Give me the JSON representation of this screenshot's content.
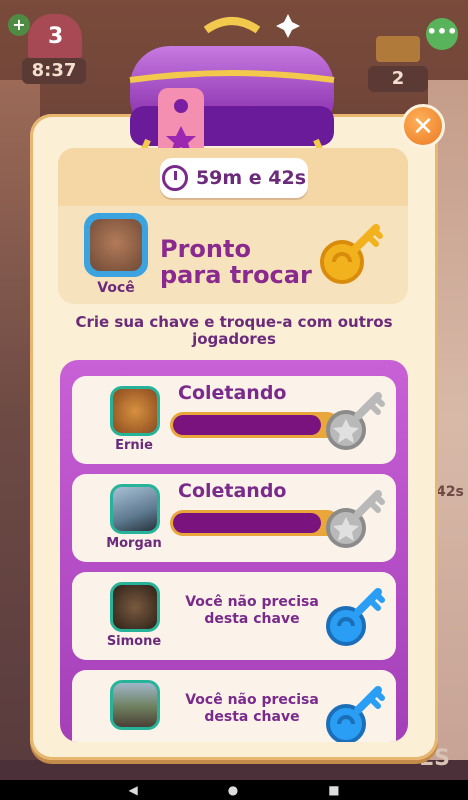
{
  "hud": {
    "lives": "3",
    "lives_timer": "8:37",
    "add_label": "+",
    "gold_count": "2",
    "menu_label": "•••"
  },
  "background": {
    "right_timer": "42s",
    "bottom_letters": "ES"
  },
  "chest": {
    "timer": "59m e 42s"
  },
  "you": {
    "label": "Você",
    "status": "Pronto para trocar"
  },
  "subtitle": "Crie sua chave e troque-a com outros jogadores",
  "rows": [
    {
      "name": "Ernie",
      "status": "Coletando",
      "type": "progress",
      "progress": 0.9
    },
    {
      "name": "Morgan",
      "status": "Coletando",
      "type": "progress",
      "progress": 0.9
    },
    {
      "name": "Simone",
      "note": "Você não precisa desta chave",
      "type": "blue-key"
    },
    {
      "name": "",
      "note": "Você não precisa desta chave",
      "type": "blue-key"
    }
  ],
  "nav": {
    "back": "◀",
    "home": "●",
    "recent": "■"
  },
  "colors": {
    "accent_purple": "#8a2a8f",
    "panel": "#fbefd6",
    "close_orange": "#ea7a22",
    "teal": "#27b39a"
  }
}
